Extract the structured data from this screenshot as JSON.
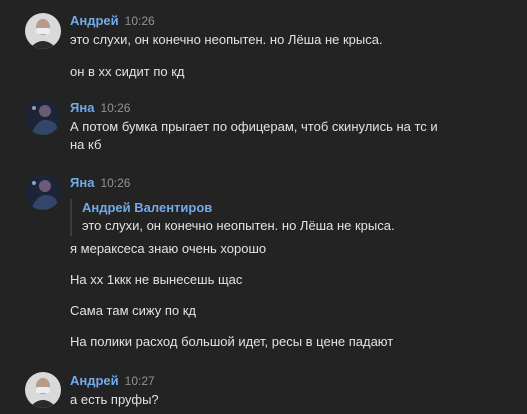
{
  "messages": [
    {
      "author": "Андрей",
      "time": "10:26",
      "avatar": "andrey-avatar",
      "lines": [
        "это слухи, он конечно неопытен. но Лёша не крыса.",
        "он в хх сидит по кд"
      ]
    },
    {
      "author": "Яна",
      "time": "10:26",
      "avatar": "yana-avatar",
      "lines": [
        "А потом бумка прыгает по офицерам, чтоб скинулись на тс и",
        "на кб"
      ]
    },
    {
      "author": "Яна",
      "time": "10:26",
      "avatar": "yana-avatar",
      "reply": {
        "author": "Андрей Валентиров",
        "text": "это слухи, он конечно неопытен. но Лёша не крыса."
      },
      "lines": [
        "я мераксеса знаю очень хорошо",
        "На хх 1ккк не вынесешь щас",
        "Сама там сижу по кд",
        "На полики расход большой идет, ресы в цене падают"
      ]
    },
    {
      "author": "Андрей",
      "time": "10:27",
      "avatar": "andrey-avatar",
      "lines": [
        "а есть пруфы?"
      ]
    }
  ],
  "colors": {
    "background": "#232323",
    "author": "#71aaeb",
    "text": "#e1e3e6",
    "time": "#939393"
  }
}
